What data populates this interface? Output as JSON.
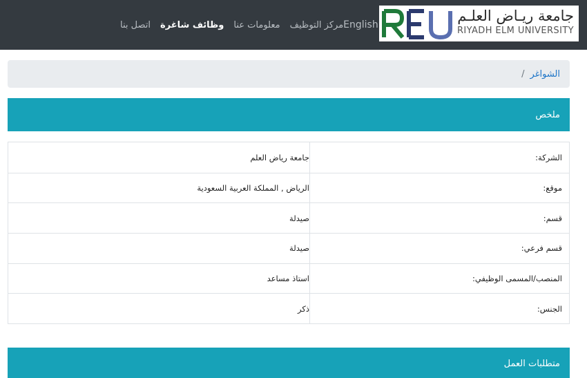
{
  "logo": {
    "mark": "REU",
    "arabic_name": "جامعة ريـاض العلـم",
    "english_name": "RIYADH ELM UNIVERSITY"
  },
  "nav": {
    "language": "English",
    "careers_center": "مركز التوظيف",
    "about": "معلومات عنا",
    "vacancies": "وظائف شاغرة",
    "contact": "اتصل بنا"
  },
  "breadcrumb": {
    "link": "الشواغر",
    "separator": "/"
  },
  "summary": {
    "title": "ملخص",
    "rows": [
      {
        "label": "الشركة:",
        "value": "جامعة رياض العلم"
      },
      {
        "label": "موقع:",
        "value": "الرياض , المملكة العربية السعودية"
      },
      {
        "label": "قسم:",
        "value": "صيدلة"
      },
      {
        "label": "قسم فرعي:",
        "value": "صيدلة"
      },
      {
        "label": "المنصب/المسمى الوظيفي:",
        "value": "استاذ مساعد"
      },
      {
        "label": "الجنس:",
        "value": "ذكر"
      }
    ]
  },
  "requirements": {
    "title": "متطلبات العمل"
  },
  "colors": {
    "navbar": "#343a40",
    "accent": "#17a2b8",
    "link": "#1a73c7",
    "breadcrumb_bg": "#e9ecef"
  }
}
